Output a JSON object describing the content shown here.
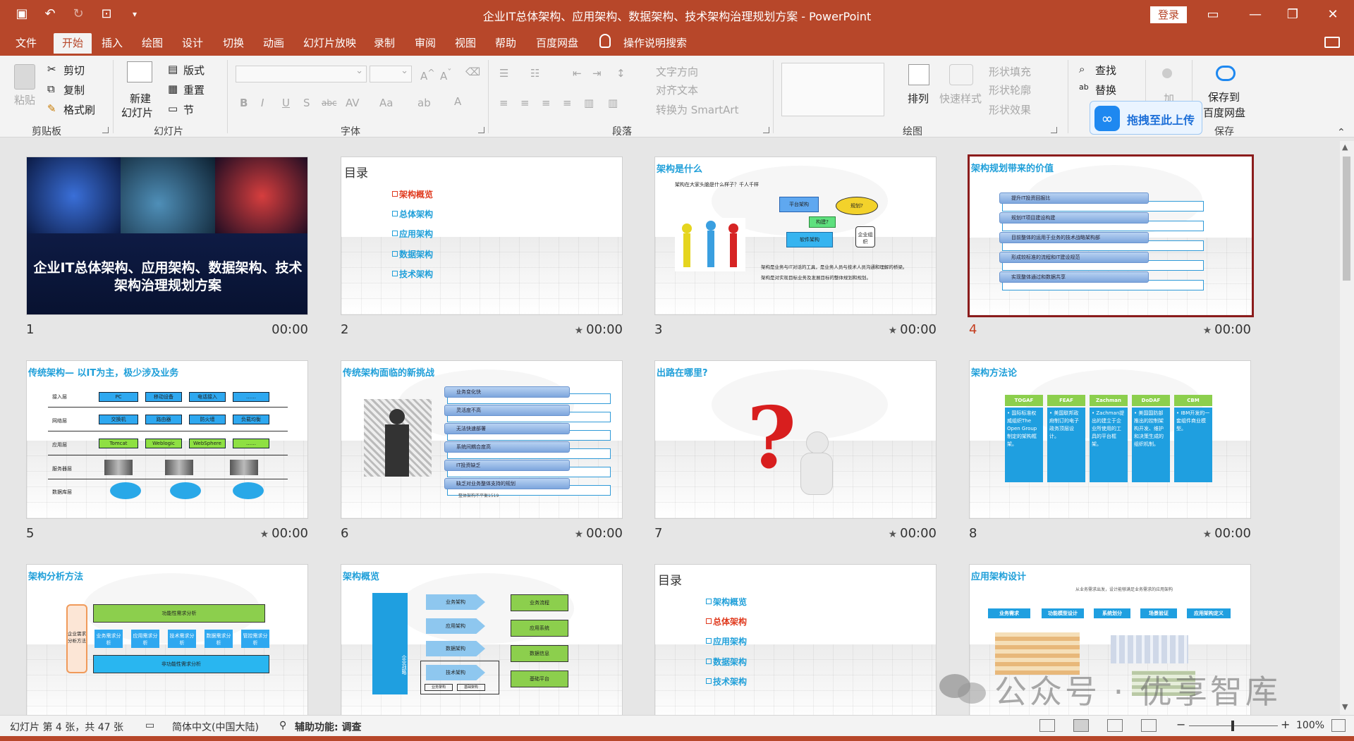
{
  "window": {
    "title": "企业IT总体架构、应用架构、数据架构、技术架构治理规划方案 - PowerPoint",
    "login": "登录"
  },
  "menu": {
    "tabs": [
      "文件",
      "开始",
      "插入",
      "绘图",
      "设计",
      "切换",
      "动画",
      "幻灯片放映",
      "录制",
      "审阅",
      "视图",
      "帮助",
      "百度网盘"
    ],
    "active": "开始",
    "tell_me": "操作说明搜索"
  },
  "ribbon": {
    "clipboard": {
      "paste": "粘贴",
      "cut": "剪切",
      "copy": "复制",
      "format_painter": "格式刷",
      "group": "剪贴板"
    },
    "slides": {
      "new_slide_1": "新建",
      "new_slide_2": "幻灯片",
      "layout": "版式",
      "reset": "重置",
      "section": "节",
      "group": "幻灯片"
    },
    "font": {
      "group": "字体"
    },
    "paragraph": {
      "text_direction": "文字方向",
      "align_text": "对齐文本",
      "smartart": "转换为 SmartArt",
      "group": "段落"
    },
    "drawing": {
      "arrange": "排列",
      "quick_styles": "快速样式",
      "shape_fill": "形状填充",
      "shape_outline": "形状轮廓",
      "shape_effects": "形状效果",
      "group": "绘图"
    },
    "editing": {
      "find": "查找",
      "replace": "替换"
    },
    "addin": {
      "label": "加"
    },
    "save": {
      "line1": "保存到",
      "line2": "百度网盘",
      "group": "保存"
    },
    "baidu_upload": "拖拽至此上传"
  },
  "slides": [
    {
      "num": "1",
      "time": "00:00",
      "title": "企业IT总体架构、应用架构、数据架构、技术架构治理规划方案"
    },
    {
      "num": "2",
      "time": "00:00",
      "title": "目录",
      "items": [
        "架构概览",
        "总体架构",
        "应用架构",
        "数据架构",
        "技术架构"
      ]
    },
    {
      "num": "3",
      "time": "00:00",
      "title": "架构是什么",
      "subtitle": "架构在大家头脑是什么样子？千人千样",
      "labels": [
        "平台架构",
        "规划?",
        "构建?",
        "软件架构",
        "企业组织"
      ],
      "notes": [
        "架构是业务与IT对话的工具，是业务人员与技术人员沟通和理解的桥梁。",
        "架构是对实现目标业务及发展目标的整体规划和规划。"
      ]
    },
    {
      "num": "4",
      "time": "00:00",
      "title": "架构规划带来的价值",
      "items": [
        "提升IT投资回报比",
        "规划IT项目建设构建",
        "目前整体的运用于业务的技术战略架构部",
        "形成较标准的流程和IT建设规范",
        "实现整体通过和数据共享"
      ]
    },
    {
      "num": "5",
      "time": "00:00",
      "title": "传统架构— 以IT为主，极少涉及业务",
      "rows": [
        "接入层",
        "网络层",
        "应用层",
        "服务器层",
        "数据库层"
      ],
      "cells": [
        "PC",
        "移动设备",
        "电话接入",
        "……",
        "交换机",
        "路由器",
        "防火墙",
        "负载均衡",
        "Tomcat",
        "Weblogic",
        "WebSphere",
        "……"
      ]
    },
    {
      "num": "6",
      "time": "00:00",
      "title": "传统架构面临的新挑战",
      "items": [
        "业务变化快",
        "灵活度不高",
        "无法快速部署",
        "系统间耦合度高",
        "IT投资缺乏",
        "缺乏对业务整体支持的规划"
      ],
      "footer": "整体架构不平衡1519"
    },
    {
      "num": "7",
      "time": "00:00",
      "title": "出路在哪里?"
    },
    {
      "num": "8",
      "time": "00:00",
      "title": "架构方法论",
      "cols": [
        {
          "head": "TOGAF",
          "body": "• 国际标准权威组织The Open Group制定的架构框架。"
        },
        {
          "head": "FEAF",
          "body": "• 美国联邦政府制订的电子政务顶层设计。"
        },
        {
          "head": "Zachman",
          "body": "• Zachman提出的建立于企业所使用的工具的平台框架。"
        },
        {
          "head": "DoDAF",
          "body": "• 美国国防部推出的控制架构开发、维护和决策生成的组织机制。"
        },
        {
          "head": "CBM",
          "body": "• IBM开发的一套组件商业模型。"
        }
      ]
    },
    {
      "num": "9",
      "title": "架构分析方法",
      "left": "企业需求分析方法",
      "top": "功能性需求分析",
      "steps": [
        "业务需求分析",
        "应用需求分析",
        "技术需求分析",
        "数据需求分析",
        "管控需求分析"
      ],
      "bottom": "非功能性需求分析"
    },
    {
      "num": "10",
      "title": "架构概览",
      "side": "企业战略",
      "mids": [
        "业务架构",
        "应用架构",
        "数据架构",
        "技术架构"
      ],
      "rights": [
        "业务流程",
        "应用系统",
        "数据信息",
        "基础平台"
      ],
      "subs": [
        "业务架构",
        "基础架构"
      ]
    },
    {
      "num": "11",
      "title": "目录",
      "items": [
        "架构概览",
        "总体架构",
        "应用架构",
        "数据架构",
        "技术架构"
      ]
    },
    {
      "num": "12",
      "title": "应用架构设计",
      "subtitle": "从业务需求出发，设计能够满足业务需求的应用架构",
      "flow": [
        "业务需求",
        "功能模型设计",
        "系统划分",
        "场景验证",
        "应用架构定义"
      ]
    }
  ],
  "status": {
    "slide_info": "幻灯片 第 4 张，共 47 张",
    "language": "简体中文(中国大陆)",
    "accessibility": "辅助功能: 调查",
    "zoom": "100%"
  },
  "watermark": "公众号 · 优享智库",
  "colors": {
    "brand": "#b7472a",
    "accent_blue": "#1f9fd9",
    "toc_current": "#e03a1e",
    "selected_border": "#8b1c1c"
  }
}
